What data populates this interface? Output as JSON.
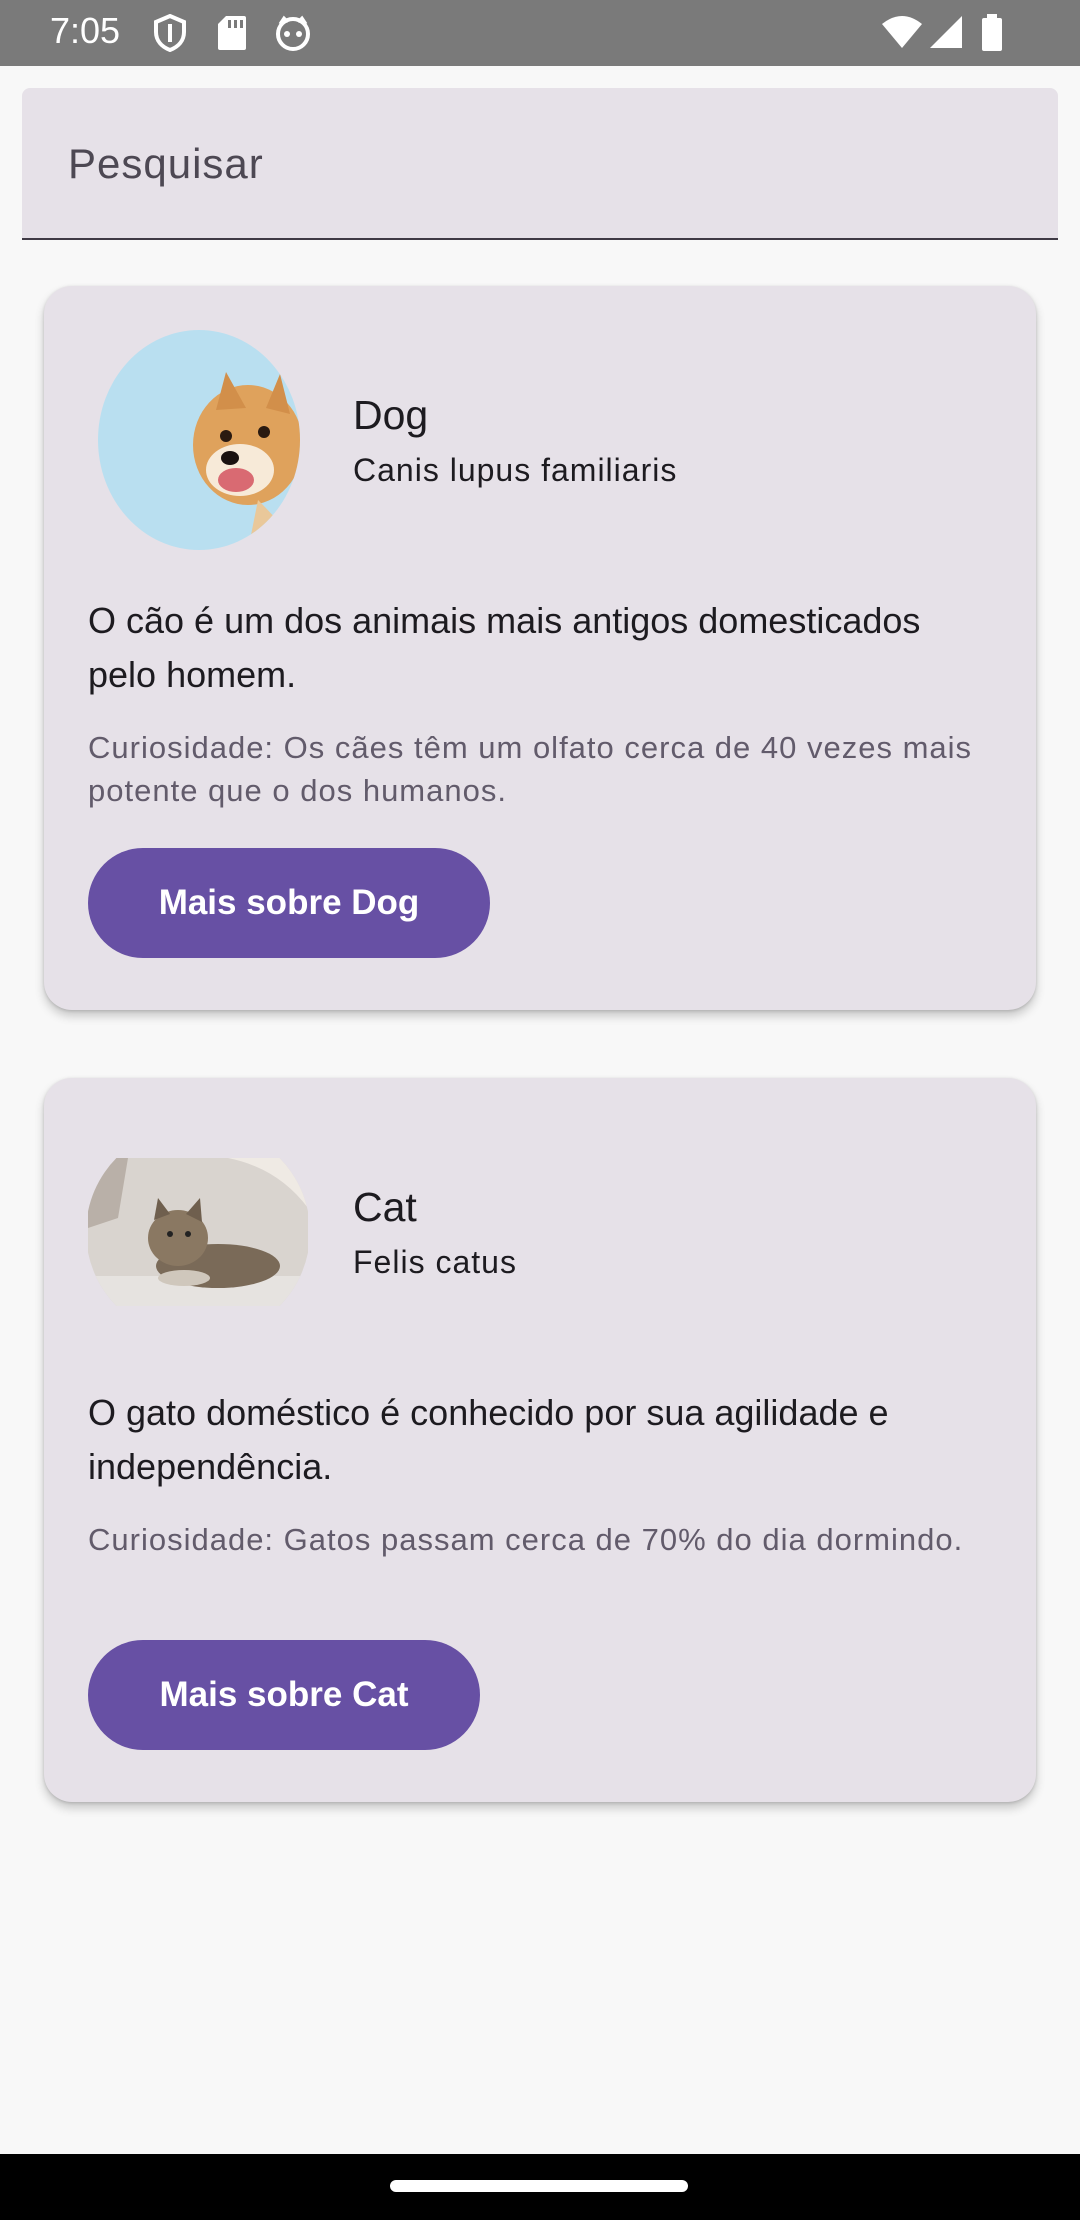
{
  "status_bar": {
    "time": "7:05",
    "icons": [
      "shield-icon",
      "sd-card-icon",
      "cat-face-icon",
      "wifi-icon",
      "signal-icon",
      "battery-icon"
    ]
  },
  "search": {
    "placeholder": "Pesquisar"
  },
  "animals": [
    {
      "name": "Dog",
      "scientific": "Canis lupus familiaris",
      "description": "O cão é um dos animais mais antigos domesticados pelo homem.",
      "curiosity": "Curiosidade: Os cães têm um olfato cerca de 40 vezes mais potente que o dos humanos.",
      "button": "Mais sobre Dog"
    },
    {
      "name": "Cat",
      "scientific": "Felis catus",
      "description": "O gato doméstico é conhecido por sua agilidade e independência.",
      "curiosity": "Curiosidade: Gatos passam cerca de 70% do dia dormindo.",
      "button": "Mais sobre Cat"
    }
  ],
  "colors": {
    "primary": "#6750a4",
    "card_bg": "#e6e1e8",
    "page_bg": "#f8f8f8"
  }
}
